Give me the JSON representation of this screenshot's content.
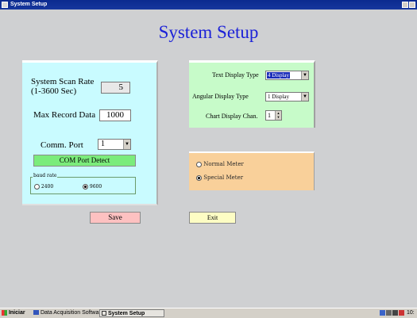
{
  "window": {
    "title": "System Setup"
  },
  "heading": "System Setup",
  "left_panel": {
    "scan_rate_label_line1": "System Scan Rate",
    "scan_rate_label_line2": "(1-3600  Sec)",
    "scan_rate_value": "5",
    "max_record_label": "Max Record Data",
    "max_record_value": "1000",
    "comm_port_label": "Comm. Port",
    "comm_port_value": "1",
    "detect_button": "COM Port Detect",
    "baud_group_label": "baud rate",
    "baud_options": [
      "2400",
      "9600"
    ],
    "baud_selected": "9600"
  },
  "display_panel": {
    "text_display_label": "Text Display Type",
    "text_display_value": "4 Display",
    "angular_display_label": "Angular Display Type",
    "angular_display_value": "1 Display",
    "chart_display_label": "Chart Display Chan.",
    "chart_display_value": "1"
  },
  "meter_panel": {
    "options": [
      "Normal Meter",
      "Special Meter"
    ],
    "selected": "Special Meter"
  },
  "buttons": {
    "save": "Save",
    "exit": "Exit"
  },
  "taskbar": {
    "start": "Iniciar",
    "items": [
      "Data Acquisition Software",
      "System Setup"
    ],
    "clock": "10:"
  },
  "colors": {
    "title_blue": "#1c22d8",
    "left_panel": "#c9fbff",
    "display_panel": "#c7fbc9",
    "meter_panel": "#f9d09a",
    "save_button": "#fdc1c1",
    "exit_button": "#fdfdc4",
    "detect_button": "#7bec7b"
  }
}
